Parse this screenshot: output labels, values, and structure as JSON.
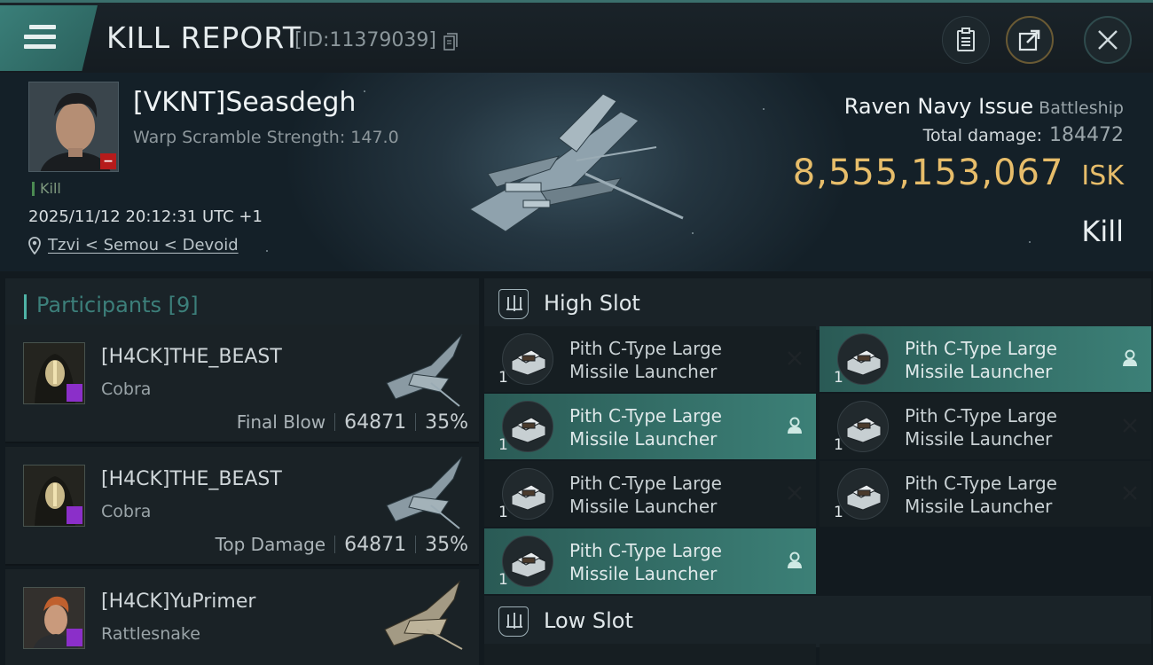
{
  "header": {
    "title": "KILL REPORT",
    "report_id": "[ID:11379039]"
  },
  "victim": {
    "pilot": "[VKNT]Seasdegh",
    "warp_scramble": "Warp Scramble Strength: 147.0",
    "kill_tag": "Kill",
    "datetime": "2025/11/12 20:12:31 UTC +1",
    "location": "Tzvi < Semou < Devoid",
    "ship_name": "Raven Navy Issue",
    "ship_class": "Battleship",
    "total_damage_label": "Total damage:",
    "total_damage": "184472",
    "isk_value": "8,555,153,067",
    "isk_unit": "ISK",
    "result": "Kill"
  },
  "participants": {
    "label": "Participants",
    "count": "[9]",
    "rows": [
      {
        "name": "[H4CK]THE_BEAST",
        "ship": "Cobra",
        "role": "Final Blow",
        "damage": "64871",
        "percent": "35%"
      },
      {
        "name": "[H4CK]THE_BEAST",
        "ship": "Cobra",
        "role": "Top Damage",
        "damage": "64871",
        "percent": "35%"
      },
      {
        "name": "[H4CK]YuPrimer",
        "ship": "Rattlesnake",
        "role": "",
        "damage": "",
        "percent": ""
      }
    ]
  },
  "slots": {
    "high": {
      "label": "High Slot",
      "modules": [
        {
          "line1": "Pith C-Type Large",
          "line2": "Missile Launcher",
          "qty": "1",
          "status": "destroyed"
        },
        {
          "line1": "Pith C-Type Large",
          "line2": "Missile Launcher",
          "qty": "1",
          "status": "dropped"
        },
        {
          "line1": "Pith C-Type Large",
          "line2": "Missile Launcher",
          "qty": "1",
          "status": "dropped"
        },
        {
          "line1": "Pith C-Type Large",
          "line2": "Missile Launcher",
          "qty": "1",
          "status": "destroyed"
        },
        {
          "line1": "Pith C-Type Large",
          "line2": "Missile Launcher",
          "qty": "1",
          "status": "destroyed"
        },
        {
          "line1": "Pith C-Type Large",
          "line2": "Missile Launcher",
          "qty": "1",
          "status": "destroyed"
        },
        {
          "line1": "Pith C-Type Large",
          "line2": "Missile Launcher",
          "qty": "1",
          "status": "dropped"
        }
      ]
    },
    "low": {
      "label": "Low Slot"
    }
  },
  "colors": {
    "accent": "#3a7f79",
    "isk": "#e7bd6a",
    "dropped_bg": "#3c8077",
    "corp_badge": "#8b2fc9",
    "victim_badge": "#b61b1b"
  },
  "icons": {
    "menu": "menu-icon",
    "copy": "copy-icon",
    "clipboard": "clipboard-icon",
    "share": "share-icon",
    "close": "close-icon",
    "location": "location-pin-icon",
    "slot": "slot-icon",
    "destroyed": "x-icon",
    "dropped": "person-icon"
  }
}
